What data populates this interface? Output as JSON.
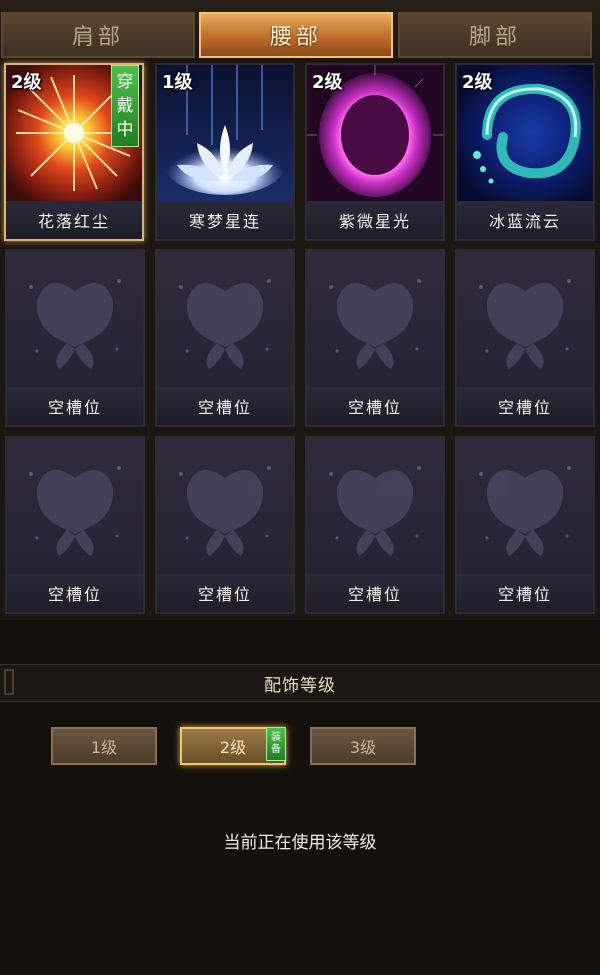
{
  "tabs": [
    {
      "label": "肩部",
      "active": false
    },
    {
      "label": "腰部",
      "active": true
    },
    {
      "label": "脚部",
      "active": false
    }
  ],
  "accessories": [
    {
      "name": "花落红尘",
      "level": "2级",
      "equipped_tag": [
        "穿",
        "戴",
        "中"
      ],
      "selected": true,
      "art": "red-burst"
    },
    {
      "name": "寒梦星连",
      "level": "1级",
      "art": "white-lotus"
    },
    {
      "name": "紫微星光",
      "level": "2级",
      "art": "purple-orb"
    },
    {
      "name": "冰蓝流云",
      "level": "2级",
      "art": "blue-swirl"
    }
  ],
  "empty_slot_label": "空槽位",
  "empty_slot_count": 8,
  "section_title": "配饰等级",
  "level_buttons": [
    {
      "label": "1级",
      "active": false
    },
    {
      "label": "2级",
      "active": true,
      "badge": [
        "装",
        "备"
      ]
    },
    {
      "label": "3级",
      "active": false
    }
  ],
  "status_text": "当前正在使用该等级"
}
